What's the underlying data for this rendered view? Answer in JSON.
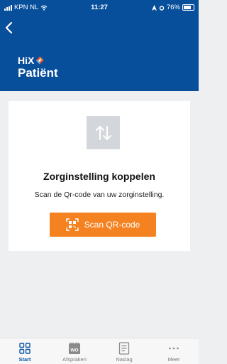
{
  "status_bar": {
    "carrier": "KPN NL",
    "time": "11:27",
    "battery": "76%"
  },
  "header": {
    "brand_top": "HiX",
    "brand_bottom": "Patiënt"
  },
  "card": {
    "title": "Zorginstelling koppelen",
    "description": "Scan de Qr-code van uw zorginstelling.",
    "button_label": "Scan QR-code"
  },
  "tabs": [
    {
      "label": "Start",
      "icon": "grid-icon",
      "active": true
    },
    {
      "label": "Afspraken",
      "icon": "calendar-icon",
      "badge": "WO"
    },
    {
      "label": "Naslag",
      "icon": "document-icon"
    },
    {
      "label": "Meer",
      "icon": "more-icon"
    }
  ],
  "colors": {
    "header_bg": "#084f9b",
    "accent_orange": "#f58220",
    "active_tab": "#0c56a6"
  }
}
